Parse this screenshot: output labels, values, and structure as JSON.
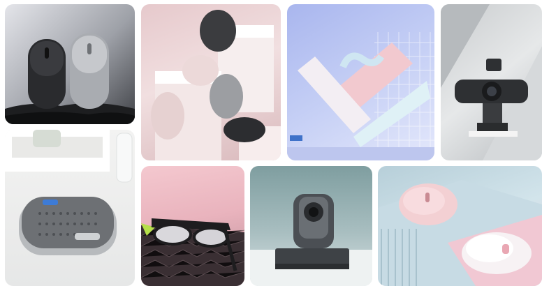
{
  "gallery": {
    "tiles": [
      {
        "id": "t1",
        "image": "wireless-mice-black-silver"
      },
      {
        "id": "t2",
        "image": "ergonomic-mice-display"
      },
      {
        "id": "t3",
        "image": "pastel-keyboards"
      },
      {
        "id": "t4",
        "image": "webcam"
      },
      {
        "id": "t5",
        "image": "conference-speakerphone"
      },
      {
        "id": "t6",
        "image": "audio-sunglasses"
      },
      {
        "id": "t7",
        "image": "ptz-camera"
      },
      {
        "id": "t8",
        "image": "pink-white-mice"
      }
    ],
    "colors": {
      "background": "#ffffff"
    }
  }
}
